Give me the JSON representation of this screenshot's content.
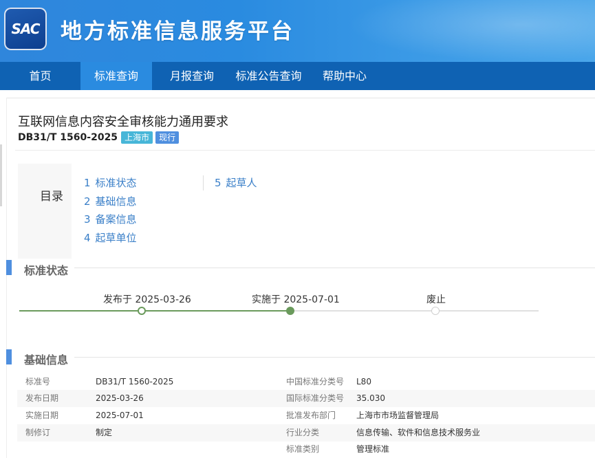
{
  "header": {
    "logo_text": "SAC",
    "site_title": "地方标准信息服务平台"
  },
  "nav": {
    "items": [
      {
        "label": "首页"
      },
      {
        "label": "标准查询"
      },
      {
        "label": "月报查询"
      },
      {
        "label": "标准公告查询"
      },
      {
        "label": "帮助中心"
      }
    ],
    "active": "标准查询"
  },
  "standard": {
    "title": "互联网信息内容安全审核能力通用要求",
    "code": "DB31/T 1560-2025",
    "region_badge": "上海市",
    "status_badge": "现行"
  },
  "toc": {
    "label": "目录",
    "items": [
      {
        "num": "1",
        "label": "标准状态"
      },
      {
        "num": "2",
        "label": "基础信息"
      },
      {
        "num": "3",
        "label": "备案信息"
      },
      {
        "num": "4",
        "label": "起草单位"
      },
      {
        "num": "5",
        "label": "起草人"
      }
    ]
  },
  "status_section": {
    "title": "标准状态",
    "timeline": [
      {
        "label": "发布于 2025-03-26",
        "state": "done"
      },
      {
        "label": "实施于 2025-07-01",
        "state": "current"
      },
      {
        "label": "废止",
        "state": "pending"
      }
    ]
  },
  "basic_section": {
    "title": "基础信息",
    "rows": [
      {
        "k1": "标准号",
        "v1": "DB31/T 1560-2025",
        "k2": "中国标准分类号",
        "v2": "L80"
      },
      {
        "k1": "发布日期",
        "v1": "2025-03-26",
        "k2": "国际标准分类号",
        "v2": "35.030"
      },
      {
        "k1": "实施日期",
        "v1": "2025-07-01",
        "k2": "批准发布部门",
        "v2": "上海市市场监督管理局"
      },
      {
        "k1": "制修订",
        "v1": "制定",
        "k2": "行业分类",
        "v2": "信息传输、软件和信息技术服务业"
      },
      {
        "k1": "",
        "v1": "",
        "k2": "标准类别",
        "v2": "管理标准"
      }
    ]
  },
  "colors": {
    "header_blue": "#2a8be0",
    "nav_blue": "#0f62b3",
    "accent": "#4f8fdf",
    "timeline_green": "#6a9a5c",
    "link": "#3a7fc8"
  }
}
